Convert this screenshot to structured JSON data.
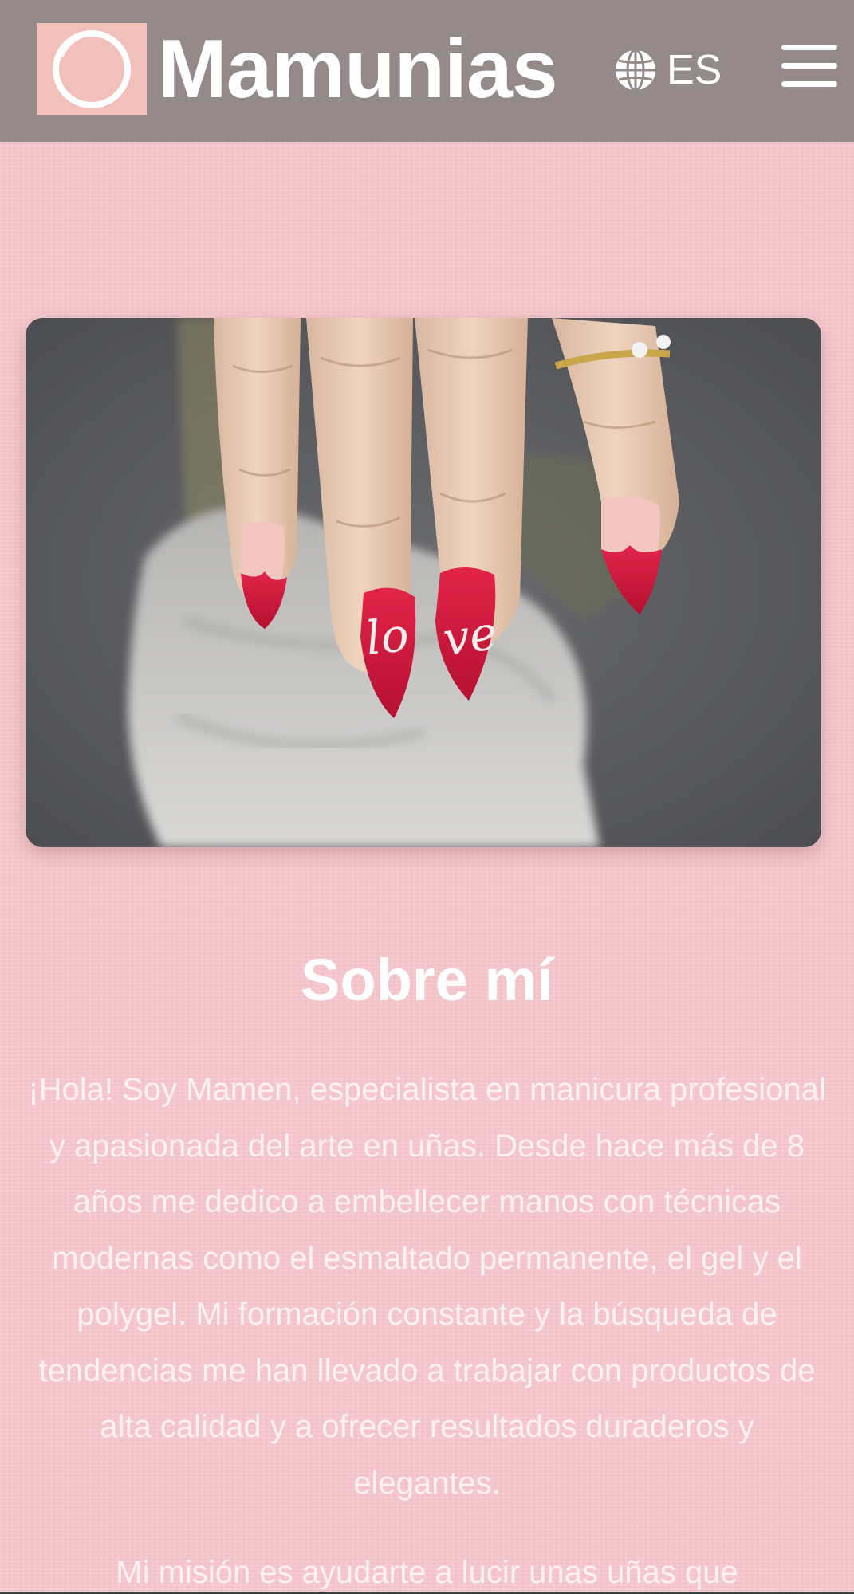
{
  "header": {
    "brand_name": "Mamunias",
    "language_label": "ES",
    "icons": {
      "logo": "ring-logo-icon",
      "language": "globe-icon",
      "menu": "hamburger-menu-icon"
    },
    "colors": {
      "header_bg": "#958a8a",
      "logo_bg": "#f2c0bb",
      "text": "#ffffff"
    }
  },
  "hero": {
    "nail_lettering": "love"
  },
  "about": {
    "title": "Sobre mí",
    "paragraphs": [
      "¡Hola! Soy Mamen, especialista en manicura profesional y apasionada del arte en uñas. Desde hace más de 8 años me dedico a embellecer manos con técnicas modernas como el esmaltado permanente, el gel y el polygel. Mi formación constante y la búsqueda de tendencias me han llevado a trabajar con productos de alta calidad y a ofrecer resultados duraderos y elegantes.",
      "Mi misión es ayudarte a lucir unas uñas que"
    ]
  },
  "theme": {
    "page_bg": "#f8c8cd",
    "text_color": "#ffffff"
  }
}
